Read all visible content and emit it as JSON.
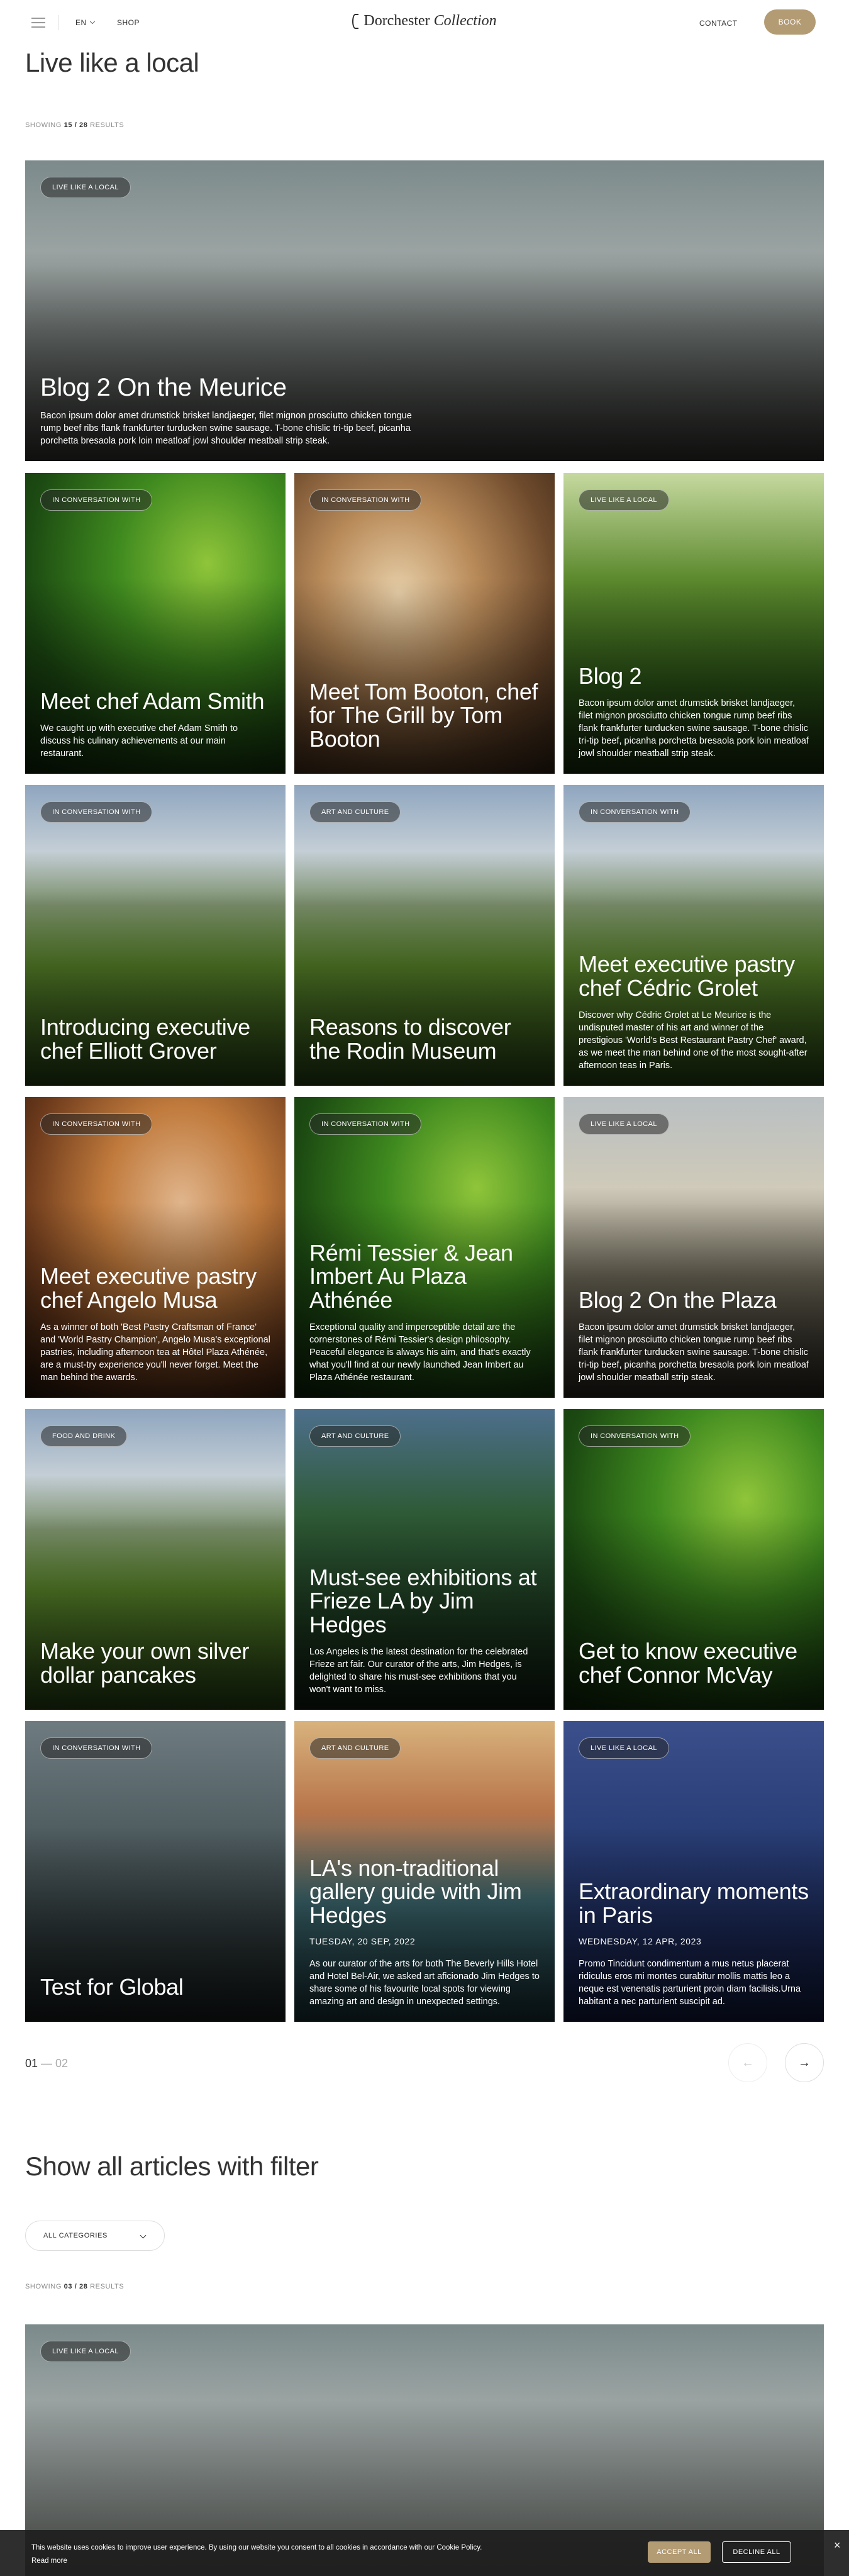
{
  "header": {
    "language": "EN",
    "shop": "SHOP",
    "logo_brand": "Dorchester",
    "logo_script": "Collection",
    "contact": "CONTACT",
    "book": "BOOK"
  },
  "section1": {
    "title": "Live like a local",
    "showing_label": "SHOWING",
    "showing_count": "15 / 28",
    "showing_suffix": "RESULTS"
  },
  "cards": [
    {
      "tag": "LIVE LIKE A LOCAL",
      "title": "Blog 2 On the Meurice",
      "desc": "Bacon ipsum dolor amet drumstick brisket landjaeger, filet mignon prosciutto chicken tongue rump beef ribs flank frankfurter turducken swine sausage. T-bone chislic tri-tip beef, picanha porchetta bresaola pork loin meatloaf jowl shoulder meatball strip steak.",
      "date": ""
    },
    {
      "tag": "IN CONVERSATION WITH",
      "title": "Meet chef Adam Smith",
      "desc": "We caught up with executive chef Adam Smith to discuss his culinary achievements at our main restaurant.",
      "date": ""
    },
    {
      "tag": "IN CONVERSATION WITH",
      "title": "Meet Tom Booton, chef for The Grill by Tom Booton",
      "desc": "",
      "date": ""
    },
    {
      "tag": "LIVE LIKE A LOCAL",
      "title": "Blog 2",
      "desc": "Bacon ipsum dolor amet drumstick brisket landjaeger, filet mignon prosciutto chicken tongue rump beef ribs flank frankfurter turducken swine sausage. T-bone chislic tri-tip beef, picanha porchetta bresaola pork loin meatloaf jowl shoulder meatball strip steak.",
      "date": ""
    },
    {
      "tag": "IN CONVERSATION WITH",
      "title": "Introducing executive chef Elliott Grover",
      "desc": "",
      "date": ""
    },
    {
      "tag": "ART AND CULTURE",
      "title": "Reasons to discover the Rodin Museum",
      "desc": "",
      "date": ""
    },
    {
      "tag": "IN CONVERSATION WITH",
      "title": "Meet executive pastry chef Cédric Grolet",
      "desc": "Discover why Cédric Grolet at Le Meurice is the undisputed master of his art and winner of the prestigious 'World's Best Restaurant Pastry Chef' award, as we meet the man behind one of the most sought-after afternoon teas in Paris.",
      "date": ""
    },
    {
      "tag": "IN CONVERSATION WITH",
      "title": "Meet executive pastry chef Angelo Musa",
      "desc": "As a winner of both 'Best Pastry Craftsman of France' and 'World Pastry Champion', Angelo Musa's exceptional pastries, including afternoon tea at Hôtel Plaza Athénée, are a must-try experience you'll never forget. Meet the man behind the awards.",
      "date": ""
    },
    {
      "tag": "IN CONVERSATION WITH",
      "title": "Rémi Tessier & Jean Imbert Au Plaza Athénée",
      "desc": "Exceptional quality and imperceptible detail are the cornerstones of Rémi Tessier's design philosophy. Peaceful elegance is always his aim, and that's exactly what you'll find at our newly launched Jean Imbert au Plaza Athénée restaurant.",
      "date": ""
    },
    {
      "tag": "LIVE LIKE A LOCAL",
      "title": "Blog 2 On the Plaza",
      "desc": "Bacon ipsum dolor amet drumstick brisket landjaeger, filet mignon prosciutto chicken tongue rump beef ribs flank frankfurter turducken swine sausage. T-bone chislic tri-tip beef, picanha porchetta bresaola pork loin meatloaf jowl shoulder meatball strip steak.",
      "date": ""
    },
    {
      "tag": "FOOD AND DRINK",
      "title": "Make your own silver dollar pancakes",
      "desc": "",
      "date": ""
    },
    {
      "tag": "ART AND CULTURE",
      "title": "Must-see exhibitions at Frieze LA by Jim Hedges",
      "desc": "Los Angeles is the latest destination for the celebrated Frieze art fair. Our curator of the arts, Jim Hedges, is delighted to share his must-see exhibitions that you won't want to miss.",
      "date": ""
    },
    {
      "tag": "IN CONVERSATION WITH",
      "title": "Get to know executive chef Connor McVay",
      "desc": "",
      "date": ""
    },
    {
      "tag": "IN CONVERSATION WITH",
      "title": "Test for Global",
      "desc": "",
      "date": ""
    },
    {
      "tag": "ART AND CULTURE",
      "title": "LA's non-traditional gallery guide with Jim Hedges",
      "desc": "As our curator of the arts for both The Beverly Hills Hotel and Hotel Bel-Air, we asked art aficionado Jim Hedges to share some of his favourite local spots for viewing amazing art and design in unexpected settings.",
      "date": "TUESDAY, 20 SEP, 2022"
    },
    {
      "tag": "LIVE LIKE A LOCAL",
      "title": "Extraordinary moments in Paris",
      "desc": "Promo Tincidunt condimentum a mus netus placerat ridiculus eros mi montes curabitur mollis mattis leo a neque est venenatis parturient proin diam facilisis.Urna habitant a nec parturient suscipit ad.",
      "date": "WEDNESDAY, 12 APR, 2023"
    }
  ],
  "pager": {
    "current": "01",
    "sep": " — ",
    "total": "02",
    "prev": "←",
    "next": "→"
  },
  "section2": {
    "title": "Show all articles with filter",
    "filter_value": "ALL CATEGORIES",
    "showing_label": "SHOWING",
    "showing_count": "03 / 28",
    "showing_suffix": "RESULTS"
  },
  "card_bottom": {
    "tag": "LIVE LIKE A LOCAL"
  },
  "cookie": {
    "text": "This website uses cookies to improve user experience. By using our website you consent to all cookies in accordance with our Cookie Policy.",
    "read_more": "Read more",
    "accept": "ACCEPT ALL",
    "decline": "DECLINE ALL",
    "close": "×"
  },
  "colors": {
    "accent": "#b39b74"
  }
}
